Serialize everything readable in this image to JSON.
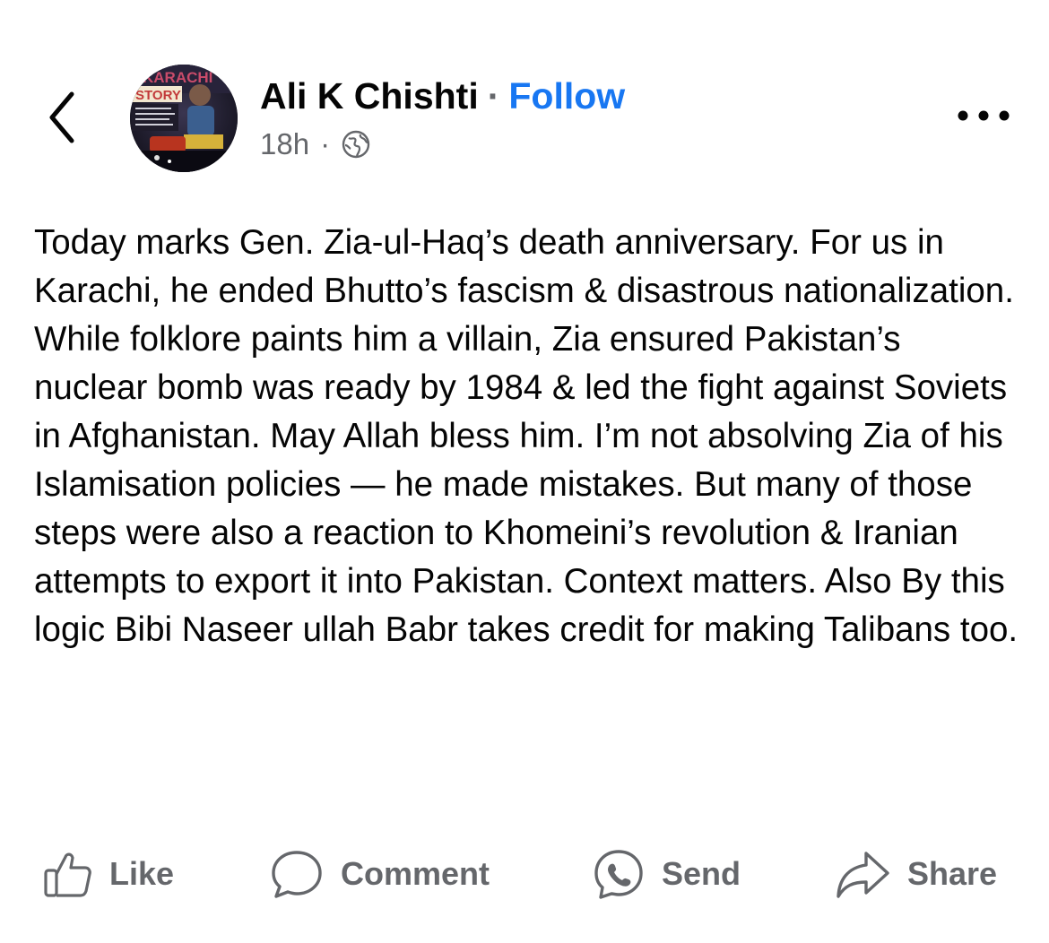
{
  "header": {
    "author_name": "Ali K Chishti",
    "separator": "·",
    "follow_label": "Follow",
    "timestamp": "18h",
    "meta_separator": "·",
    "back_icon": "chevron-left-icon",
    "privacy_icon": "globe-icon",
    "more_icon": "more-options-icon",
    "avatar_text": "STORY",
    "avatar_banner_text": "KARACHI"
  },
  "post": {
    "text": "Today marks Gen. Zia-ul-Haq’s death anniversary. For us in Karachi, he ended Bhutto’s fascism & disastrous nationalization. While folklore paints him a villain, Zia ensured Pakistan’s nuclear bomb was ready by 1984 & led the fight against Soviets in Afghanistan. May Allah bless him. I’m not absolving Zia of his Islamisation policies — he made mistakes. But many of those steps were also a reaction to Khomeini’s revolution & Iranian attempts to export it into Pakistan. Context matters. Also By this logic Bibi Naseer ullah Babr takes credit for making Talibans too."
  },
  "actions": [
    {
      "label": "Like",
      "icon": "thumbs-up-icon"
    },
    {
      "label": "Comment",
      "icon": "comment-bubble-icon"
    },
    {
      "label": "Send",
      "icon": "messenger-send-icon"
    },
    {
      "label": "Share",
      "icon": "share-arrow-icon"
    }
  ],
  "colors": {
    "accent": "#1877f2",
    "text_primary": "#050505",
    "text_secondary": "#65676b",
    "background": "#ffffff"
  }
}
